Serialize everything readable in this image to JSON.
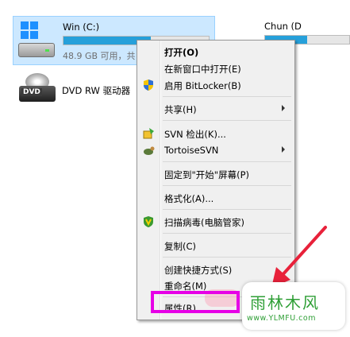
{
  "drives": {
    "c": {
      "name": "Win (C:)",
      "free_text": "48.9 GB 可用，共",
      "usage_fraction": 0.6
    },
    "d": {
      "name": "Chun (D",
      "usage_fraction": 0.5
    },
    "dvd": {
      "name": "DVD RW 驱动器",
      "icon_text": "DVD"
    }
  },
  "context_menu": {
    "items": [
      {
        "label": "打开(O)",
        "bold": true
      },
      {
        "label": "在新窗口中打开(E)"
      },
      {
        "label": "启用 BitLocker(B)",
        "icon": "shield-icon"
      },
      {
        "label": "共享(H)",
        "submenu": true
      },
      {
        "label": "SVN 检出(K)...",
        "icon": "svn-checkout-icon"
      },
      {
        "label": "TortoiseSVN",
        "icon": "tortoise-icon",
        "submenu": true
      },
      {
        "label": "固定到\"开始\"屏幕(P)"
      },
      {
        "label": "格式化(A)..."
      },
      {
        "label": "扫描病毒(电脑管家)",
        "icon": "tencent-shield-icon"
      },
      {
        "label": "复制(C)"
      },
      {
        "label": "创建快捷方式(S)"
      },
      {
        "label": "重命名(M)"
      },
      {
        "label": "属性(R)"
      }
    ]
  },
  "watermark": {
    "title": "雨林木风",
    "url": "www.YLMFU.com"
  },
  "colors": {
    "selection_bg": "#cce8ff",
    "bar_fill": "#26a0da",
    "highlight_box": "#e600e6",
    "arrow": "#e8213a",
    "watermark": "#2f9f36"
  }
}
